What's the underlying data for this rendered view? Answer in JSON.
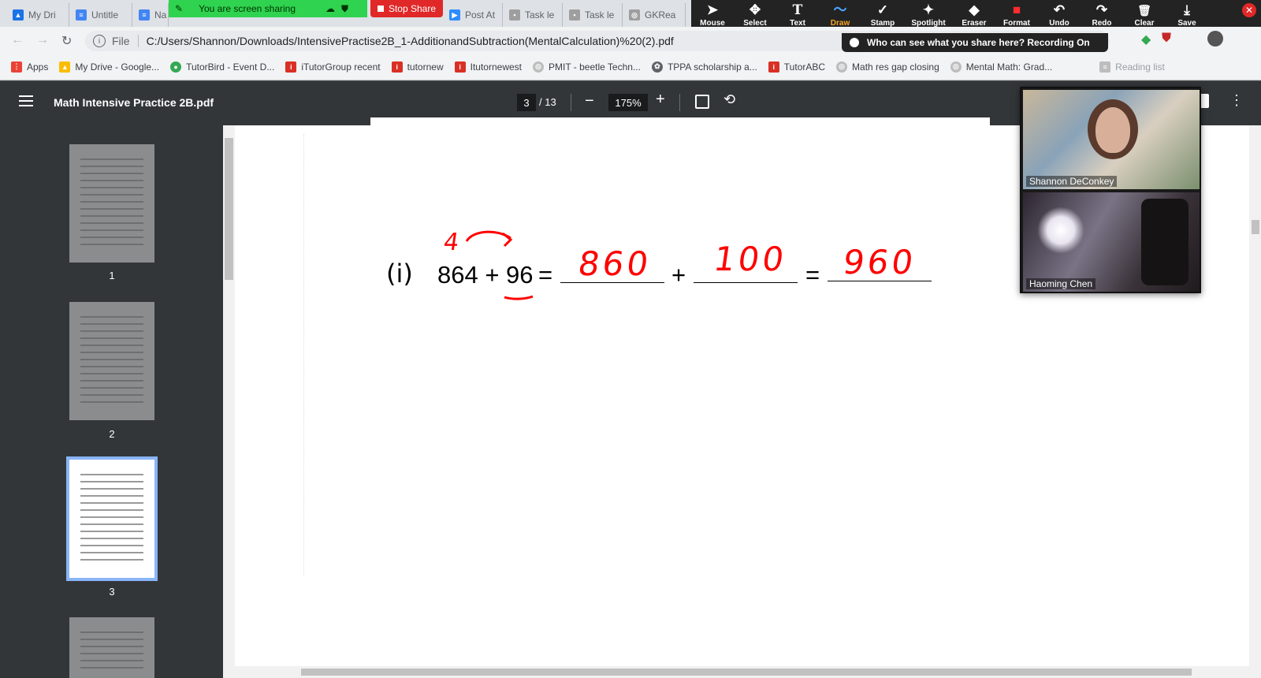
{
  "tabs": [
    {
      "label": "My Dri",
      "fav_color": "#1a73e8",
      "fav_icon": "drive-icon"
    },
    {
      "label": "Untitle",
      "fav_color": "#4285f4",
      "fav_icon": "docs-icon"
    },
    {
      "label": "Na",
      "fav_color": "#4285f4",
      "fav_icon": "docs-icon"
    },
    {
      "label": "Post At",
      "fav_color": "#2d8cff",
      "fav_icon": "zoom-icon"
    },
    {
      "label": "Task le",
      "fav_color": "#9e9e9e",
      "fav_icon": "page-icon"
    },
    {
      "label": "Task le",
      "fav_color": "#9e9e9e",
      "fav_icon": "page-icon"
    },
    {
      "label": "GKRea",
      "fav_color": "#9e9e9e",
      "fav_icon": "globe-icon"
    }
  ],
  "share": {
    "banner": "You are screen sharing",
    "stop_label": "Stop Share"
  },
  "annotation_toolbar": {
    "tools": [
      {
        "label": "Mouse",
        "icon": "cursor-icon",
        "glyph": "➤"
      },
      {
        "label": "Select",
        "icon": "move-icon",
        "glyph": "✥"
      },
      {
        "label": "Text",
        "icon": "text-icon",
        "glyph": "T"
      },
      {
        "label": "Draw",
        "icon": "draw-icon",
        "glyph": "〜"
      },
      {
        "label": "Stamp",
        "icon": "stamp-icon",
        "glyph": "✓"
      },
      {
        "label": "Spotlight",
        "icon": "spotlight-icon",
        "glyph": "✦"
      },
      {
        "label": "Eraser",
        "icon": "eraser-icon",
        "glyph": "◆"
      },
      {
        "label": "Format",
        "icon": "format-icon",
        "glyph": "■"
      },
      {
        "label": "Undo",
        "icon": "undo-icon",
        "glyph": "↶"
      },
      {
        "label": "Redo",
        "icon": "redo-icon",
        "glyph": "↷"
      },
      {
        "label": "Clear",
        "icon": "trash-icon",
        "glyph": "🗑"
      },
      {
        "label": "Save",
        "icon": "save-icon",
        "glyph": "⤓"
      }
    ],
    "active_tool": "Draw",
    "active_color": "#f5a623",
    "format_color": "#ff2d2d"
  },
  "address": {
    "scheme_label": "File",
    "url": "C:/Users/Shannon/Downloads/IntensivePractise2B_1-AdditionandSubtraction(MentalCalculation)%20(2).pdf"
  },
  "who_share": "Who can see what you share here? Recording On",
  "bookmarks": [
    {
      "label": "Apps",
      "color": "#ea4335"
    },
    {
      "label": "My Drive - Google...",
      "color": "#fbbc04"
    },
    {
      "label": "TutorBird - Event D...",
      "color": "#34a853"
    },
    {
      "label": "iTutorGroup recent",
      "color": "#d93025"
    },
    {
      "label": "tutornew",
      "color": "#d93025"
    },
    {
      "label": "Itutornewest",
      "color": "#d93025"
    },
    {
      "label": "PMIT - beetle Techn...",
      "color": "#9e9e9e"
    },
    {
      "label": "TPPA scholarship a...",
      "color": "#5f6368"
    },
    {
      "label": "TutorABC",
      "color": "#d93025"
    },
    {
      "label": "Math res gap closing",
      "color": "#9e9e9e"
    },
    {
      "label": "Mental Math: Grad...",
      "color": "#9e9e9e"
    },
    {
      "label": "Reading list",
      "color": "#9e9e9e"
    }
  ],
  "pdf": {
    "title": "Math Intensive Practice 2B.pdf",
    "current_page": "3",
    "total_pages": "/ 13",
    "zoom": "175%",
    "thumbnails": [
      "1",
      "2",
      "3"
    ],
    "selected_page": "3"
  },
  "problem": {
    "label": "(i)",
    "expression": "864 + 96",
    "equals": "=",
    "plus": "+",
    "answer_1": "860",
    "answer_2": "100",
    "answer_3": "960",
    "moved_digit": "4",
    "ink_color": "#ff0000"
  },
  "participants": [
    {
      "name": "Shannon DeConkey"
    },
    {
      "name": "Haoming Chen"
    }
  ]
}
